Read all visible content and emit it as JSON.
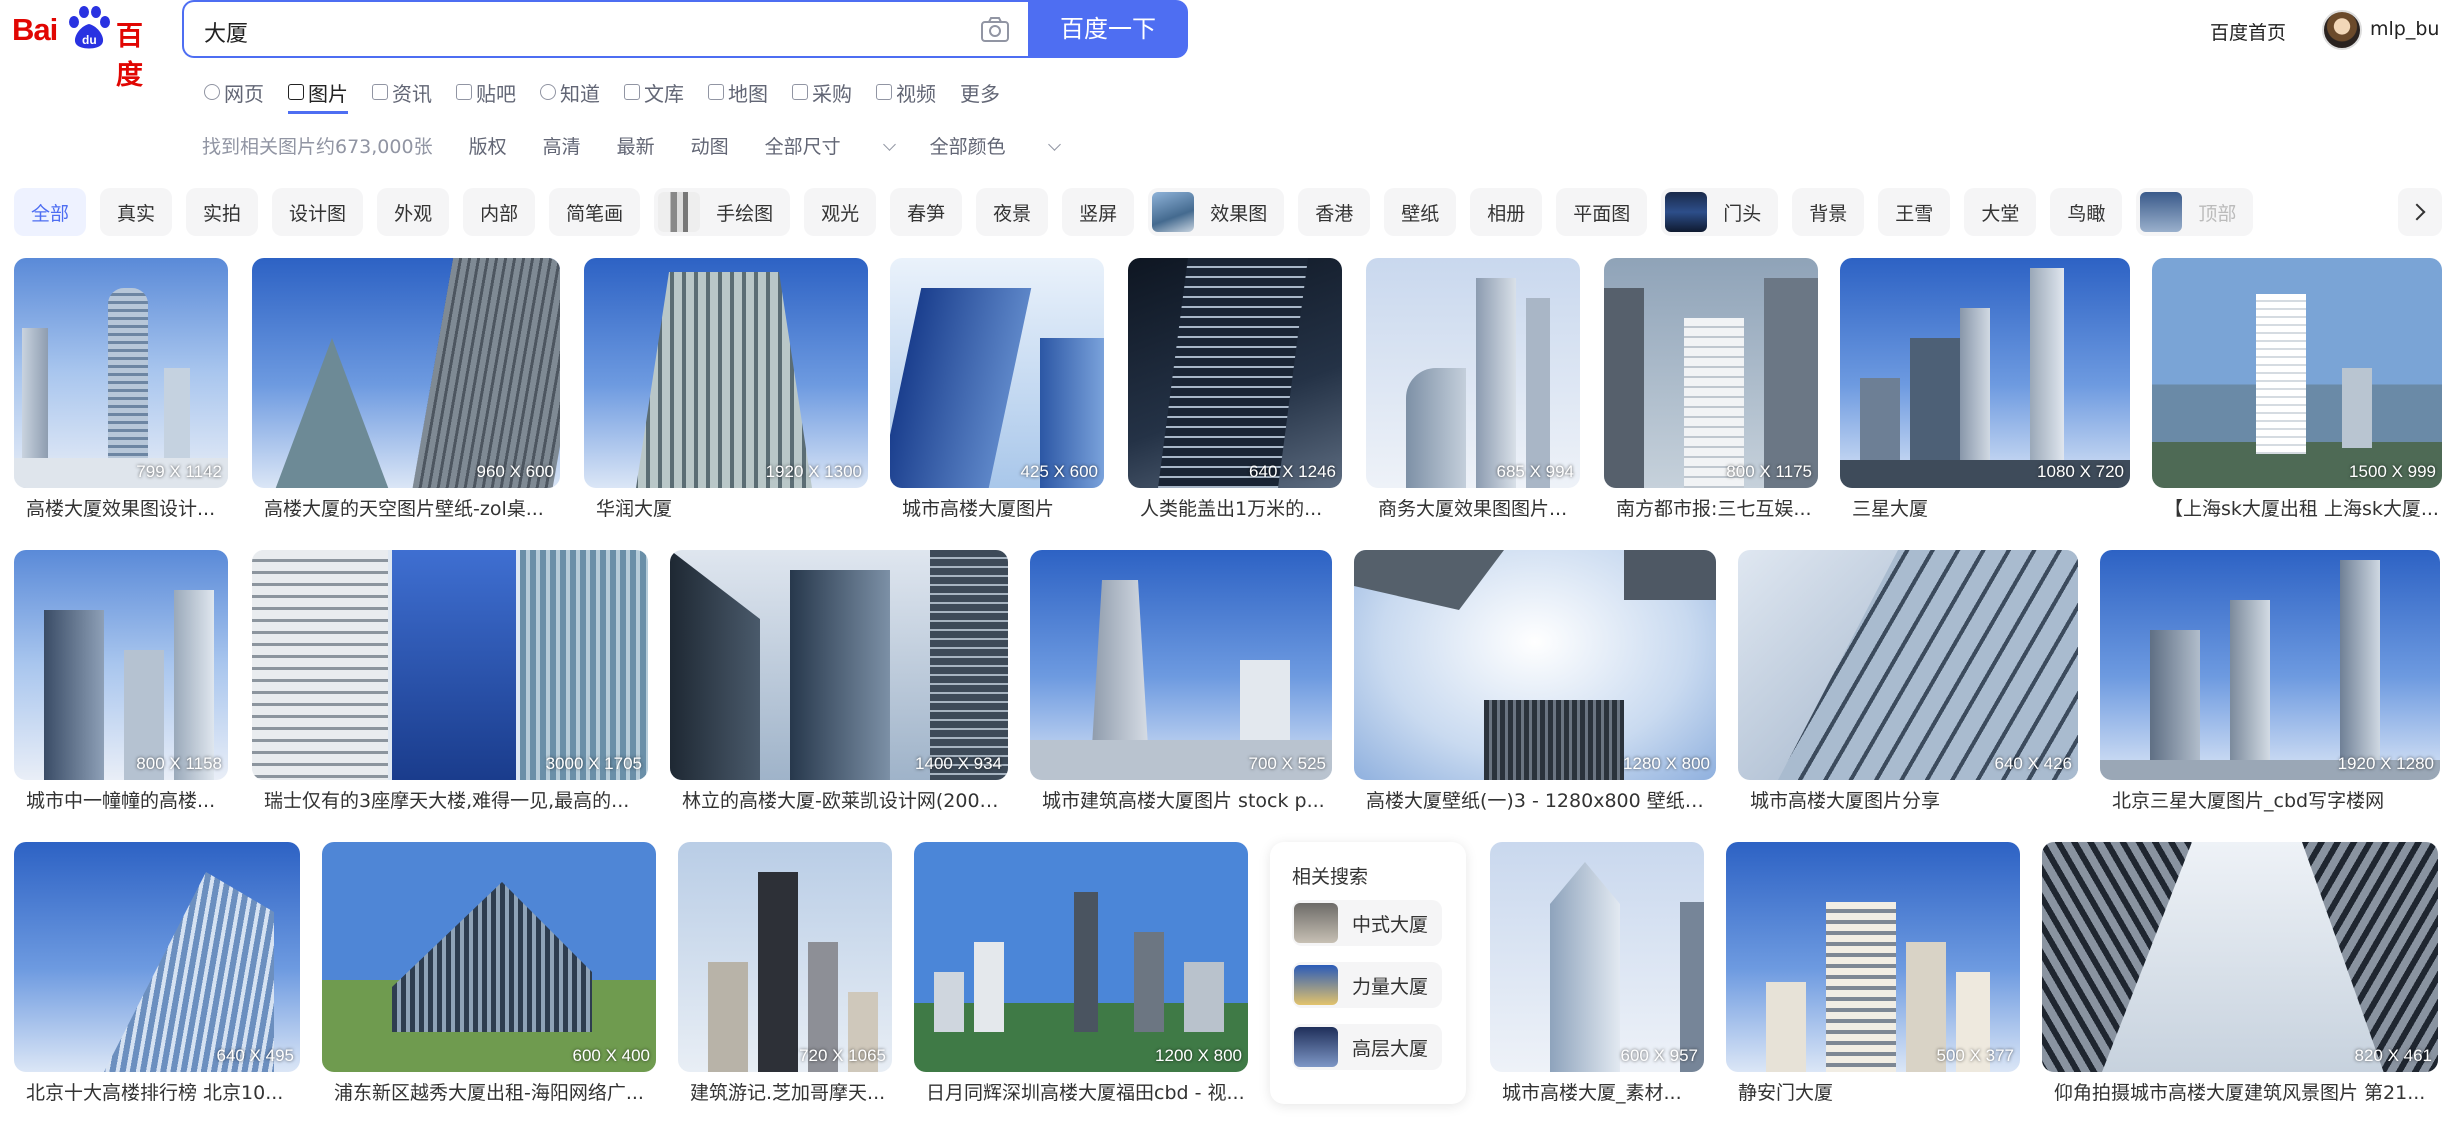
{
  "header": {
    "logo_text_left": "Bai",
    "logo_text_right": "百度",
    "search_query": "大厦",
    "search_button": "百度一下",
    "home_link": "百度首页",
    "username": "mlp_bu"
  },
  "tabs": [
    "网页",
    "图片",
    "资讯",
    "贴吧",
    "知道",
    "文库",
    "地图",
    "采购",
    "视频",
    "更多"
  ],
  "active_tab": "图片",
  "filters": {
    "result_count": "找到相关图片约673,000张",
    "options": [
      "版权",
      "高清",
      "最新",
      "动图"
    ],
    "size_dropdown": "全部尺寸",
    "color_dropdown": "全部颜色"
  },
  "chips": [
    "全部",
    "真实",
    "实拍",
    "设计图",
    "外观",
    "内部",
    "简笔画",
    "手绘图",
    "观光",
    "春笋",
    "夜景",
    "竖屏",
    "效果图",
    "香港",
    "壁纸",
    "相册",
    "平面图",
    "门头",
    "背景",
    "王雪",
    "大堂",
    "鸟瞰",
    "顶部"
  ],
  "results": [
    {
      "dim": "799 X 1142",
      "caption": "高楼大厦效果图设计..."
    },
    {
      "dim": "960 X 600",
      "caption": "高楼大厦的天空图片壁纸-zol桌..."
    },
    {
      "dim": "1920 X 1300",
      "caption": "华润大厦"
    },
    {
      "dim": "425 X 600",
      "caption": "城市高楼大厦图片"
    },
    {
      "dim": "640 X 1246",
      "caption": "人类能盖出1万米的..."
    },
    {
      "dim": "685 X 994",
      "caption": "商务大厦效果图图片..."
    },
    {
      "dim": "800 X 1175",
      "caption": "南方都市报:三七互娱..."
    },
    {
      "dim": "1080 X 720",
      "caption": "三星大厦"
    },
    {
      "dim": "1500 X 999",
      "caption": "【上海sk大厦出租 上海sk大厦..."
    },
    {
      "dim": "800 X 1158",
      "caption": "城市中一幢幢的高楼..."
    },
    {
      "dim": "3000 X 1705",
      "caption": "瑞士仅有的3座摩天大楼,难得一见,最高的..."
    },
    {
      "dim": "1400 X 934",
      "caption": "林立的高楼大厦-欧莱凯设计网(2008..."
    },
    {
      "dim": "700 X 525",
      "caption": "城市建筑高楼大厦图片 stock p..."
    },
    {
      "dim": "1280 X 800",
      "caption": "高楼大厦壁纸(一)3 - 1280x800 壁纸下..."
    },
    {
      "dim": "640 X 426",
      "caption": "城市高楼大厦图片分享"
    },
    {
      "dim": "1920 X 1280",
      "caption": "北京三星大厦图片_cbd写字楼网"
    },
    {
      "dim": "640 X 495",
      "caption": "北京十大高楼排行榜 北京10..."
    },
    {
      "dim": "600 X 400",
      "caption": "浦东新区越秀大厦出租-海阳网络广..."
    },
    {
      "dim": "720 X 1065",
      "caption": "建筑游记.芝加哥摩天..."
    },
    {
      "dim": "1200 X 800",
      "caption": "日月同辉深圳高楼大厦福田cbd - 视..."
    },
    {
      "dim": "600 X 957",
      "caption": "城市高楼大厦_素材..."
    },
    {
      "dim": "500 X 377",
      "caption": "静安门大厦"
    },
    {
      "dim": "820 X 461",
      "caption": "仰角拍摄城市高楼大厦建筑风景图片 第21..."
    }
  ],
  "related": {
    "heading": "相关搜索",
    "items": [
      "中式大厦",
      "力量大厦",
      "高层大厦"
    ]
  },
  "colors": {
    "brand_red": "#e10602",
    "accent_blue": "#4e6ef2"
  }
}
